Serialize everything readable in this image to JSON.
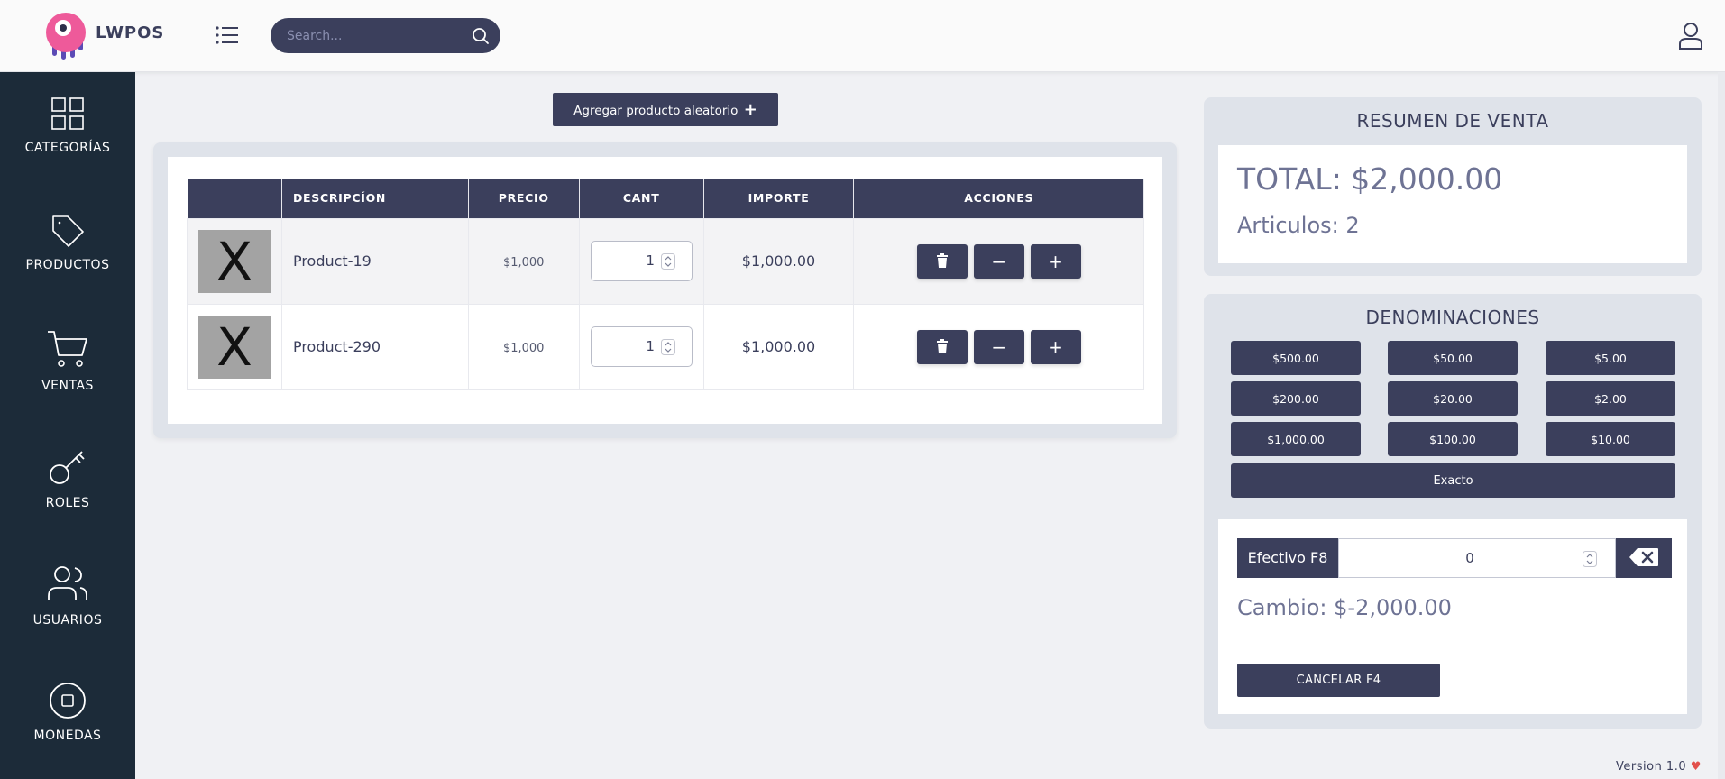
{
  "header": {
    "brand": "LWPOS",
    "search_placeholder": "Search..."
  },
  "sidebar": {
    "items": [
      {
        "label": "CATEGORÍAS",
        "icon": "grid-icon"
      },
      {
        "label": "PRODUCTOS",
        "icon": "tag-icon"
      },
      {
        "label": "VENTAS",
        "icon": "cart-icon"
      },
      {
        "label": "ROLES",
        "icon": "key-icon"
      },
      {
        "label": "USUARIOS",
        "icon": "users-icon"
      },
      {
        "label": "MONEDAS",
        "icon": "coin-icon"
      }
    ]
  },
  "main": {
    "add_random_label": "Agregar producto aleatorio",
    "add_random_icon": "+",
    "table": {
      "headers": [
        "",
        "DESCRIPCÍON",
        "PRECIO",
        "CANT",
        "IMPORTE",
        "ACCIONES"
      ],
      "rows": [
        {
          "thumb": "X",
          "description": "Product-19",
          "price": "$1,000",
          "qty": "1",
          "amount": "$1,000.00"
        },
        {
          "thumb": "X",
          "description": "Product-290",
          "price": "$1,000",
          "qty": "1",
          "amount": "$1,000.00"
        }
      ],
      "actions": {
        "delete_icon": "trash-icon",
        "decrement": "−",
        "increment": "+"
      }
    }
  },
  "resumen": {
    "title": "RESUMEN DE VENTA",
    "total": "TOTAL: $2,000.00",
    "articulos": "Articulos: 2"
  },
  "denominaciones": {
    "title": "DENOMINACIONES",
    "buttons": [
      "$500.00",
      "$50.00",
      "$5.00",
      "$200.00",
      "$20.00",
      "$2.00",
      "$1,000.00",
      "$100.00",
      "$10.00"
    ],
    "exacto": "Exacto",
    "efectivo_label": "Efectivo F8",
    "efectivo_value": "0",
    "cambio": "Cambio: $-2,000.00",
    "cancel_label": "CANCELAR F4"
  },
  "footer": {
    "version": "Version 1.0"
  },
  "colors": {
    "primary": "#3b3f5c",
    "sidebar": "#1c2b39",
    "background": "#f0f1f4",
    "heart": "#e2504c"
  }
}
